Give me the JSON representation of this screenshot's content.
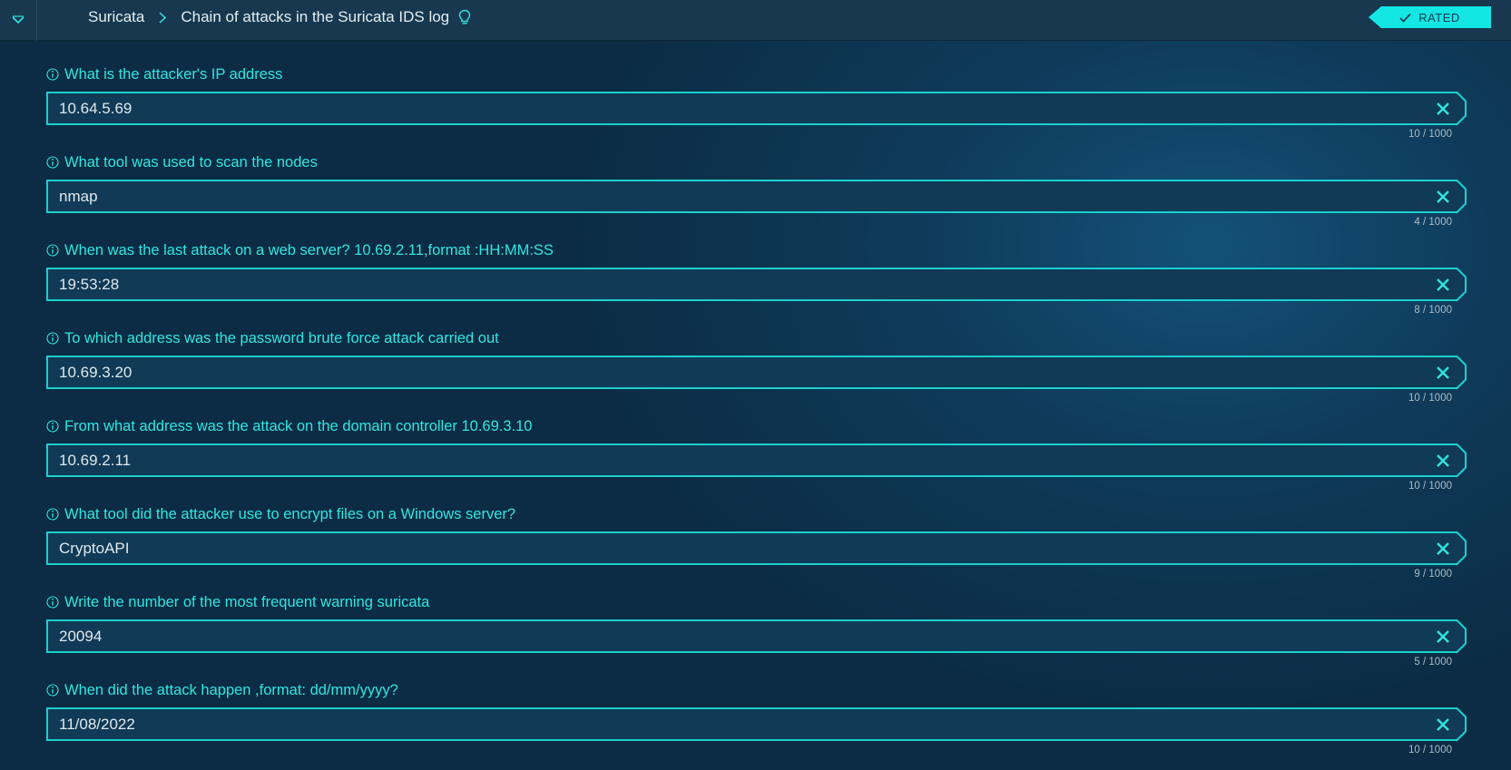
{
  "header": {
    "breadcrumb_root": "Suricata",
    "breadcrumb_current": "Chain of attacks in the Suricata IDS log",
    "rated_label": "RATED",
    "menu_icon": "chevron-down-icon",
    "hint_icon": "lightbulb-icon"
  },
  "colors": {
    "accent": "#2fe6e0",
    "badge": "#14e6e4",
    "background": "#0f3b5a"
  },
  "questions": [
    {
      "label": "What is the attacker's IP address",
      "value": "10.64.5.69",
      "counter": "10 / 1000"
    },
    {
      "label": "What tool was used to scan the nodes",
      "value": "nmap",
      "counter": "4 / 1000"
    },
    {
      "label": "When was the last attack on a web server? 10.69.2.11,format :HH:MM:SS",
      "value": "19:53:28",
      "counter": "8 / 1000"
    },
    {
      "label": "To which address was the password brute force attack carried out",
      "value": "10.69.3.20",
      "counter": "10 / 1000"
    },
    {
      "label": "From what address was the attack on the domain controller 10.69.3.10",
      "value": "10.69.2.11",
      "counter": "10 / 1000"
    },
    {
      "label": "What tool did the attacker use to encrypt files on a Windows server?",
      "value": "CryptoAPI",
      "counter": "9 / 1000"
    },
    {
      "label": "Write the number of the most frequent warning suricata",
      "value": "20094",
      "counter": "5 / 1000"
    },
    {
      "label": "When did the attack happen ,format: dd/mm/yyyy?",
      "value": "11/08/2022",
      "counter": "10 / 1000"
    }
  ]
}
